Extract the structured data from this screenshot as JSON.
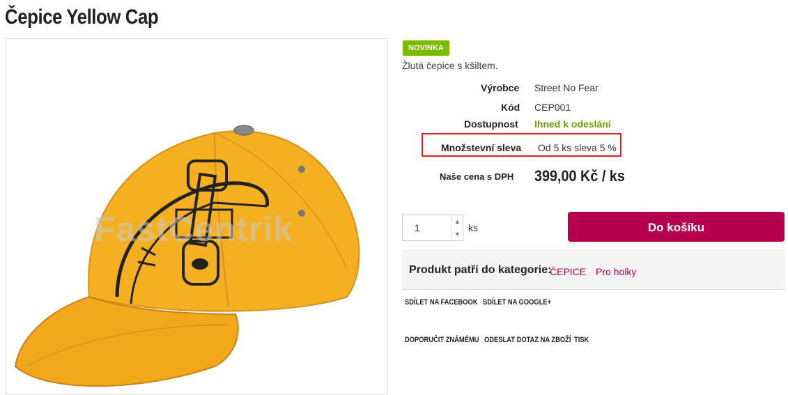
{
  "product": {
    "title": "Čepice Yellow Cap",
    "badge": "NOVINKA",
    "short_description": "Žlutá čepice s kšiltem.",
    "image_watermark": "FastCentrik"
  },
  "params": {
    "manufacturer_label": "Výrobce",
    "manufacturer_value": "Street No Fear",
    "code_label": "Kód",
    "code_value": "CEP001",
    "availability_label": "Dostupnost",
    "availability_value": "Ihned k odeslání",
    "discount_label": "Množstevní sleva",
    "discount_value": "Od 5 ks sleva 5 %",
    "price_label": "Naše cena s DPH",
    "price_value": "399,00 Kč / ks"
  },
  "buy": {
    "quantity": "1",
    "unit": "ks",
    "cart_label": "Do košíku"
  },
  "category": {
    "label": "Produkt patří do kategorie:",
    "links": [
      "ČEPICE",
      "Pro holky"
    ]
  },
  "share": {
    "facebook": "SDÍLET NA FACEBOOK",
    "google": "SDÍLET NA GOOGLE+",
    "recommend": "DOPORUČIT ZNÁMÉMU",
    "ask": "ODESLAT DOTAZ NA ZBOŽÍ",
    "print": "TISK"
  },
  "colors": {
    "accent": "#b5004d",
    "badge": "#7dbb00",
    "availability": "#6aa100",
    "highlight_border": "#e31e24",
    "cap_yellow": "#f5b021"
  }
}
